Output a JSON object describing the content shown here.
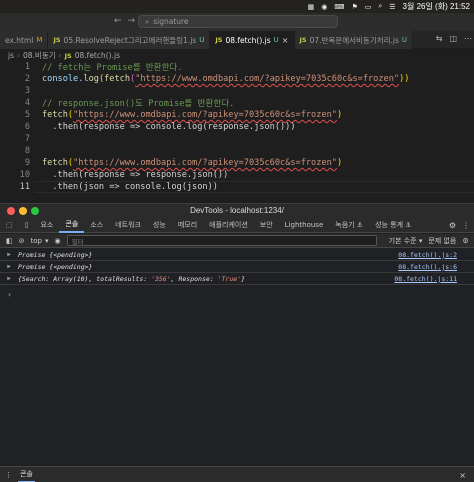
{
  "menubar": {
    "date_time": "3월 26일 (화) 21:52",
    "icons": [
      "menu-extra-icon",
      "wifi-icon",
      "keyboard-icon",
      "flag-icon",
      "battery-icon",
      "search-icon",
      "control-center-icon"
    ]
  },
  "titlebar": {
    "search_placeholder": "signature"
  },
  "tabs": [
    {
      "label": "ex.html",
      "badge": "",
      "status": "M",
      "active": false
    },
    {
      "label": "05.ResolveReject그리고에러핸들링1.js",
      "badge": "JS",
      "status": "U",
      "active": false
    },
    {
      "label": "08.fetch().js",
      "badge": "JS",
      "status": "U",
      "active": true
    },
    {
      "label": "07.반복문에서비동기처리.js",
      "badge": "JS",
      "status": "U",
      "active": false
    }
  ],
  "breadcrumb": [
    "js",
    "08.비동기",
    "08.fetch().js"
  ],
  "breadcrumb_badge": "JS",
  "editor": {
    "lines": [
      {
        "n": "1",
        "cmt": "// fetch는 Promise를 반환한다."
      },
      {
        "n": "2",
        "pre": "console.",
        "fn": "log",
        "a": "(",
        "fn2": "fetch",
        "b": "(",
        "url": "\"https://www.omdbapi.com/?apikey=7035c60c&s=frozen\"",
        "c": "))"
      },
      {
        "n": "3"
      },
      {
        "n": "4",
        "cmt": "// response.json()도 Promise를 반환한다."
      },
      {
        "n": "5",
        "fn": "fetch",
        "a": "(",
        "url": "\"https://www.omdbapi.com/?apikey=7035c60c&s=frozen\"",
        "c": ")"
      },
      {
        "n": "6",
        "text": "  .then(response => console.log(response.json()))"
      },
      {
        "n": "7"
      },
      {
        "n": "8"
      },
      {
        "n": "9",
        "fn": "fetch",
        "a": "(",
        "url": "\"https://www.omdbapi.com/?apikey=7035c60c&s=frozen\"",
        "c": ")"
      },
      {
        "n": "10",
        "text": "  .then(response => response.json())"
      },
      {
        "n": "11",
        "text": "  .then(json => console.log(json))"
      }
    ]
  },
  "devtools": {
    "window_title": "DevTools - localhost:1234/",
    "tabs": [
      "요소",
      "콘솔",
      "소스",
      "네트워크",
      "성능",
      "메모리",
      "애플리케이션",
      "보안",
      "Lighthouse",
      "녹음기 ⚓",
      "성능 통계 ⚓"
    ],
    "active_tab": "콘솔",
    "context": "top",
    "filter_placeholder": "필터",
    "levels": "기본 수준 ▾",
    "issues": "문제 없음",
    "messages": [
      {
        "text": "Promise {<pending>}",
        "source": "08.fetch().js:2"
      },
      {
        "text": "Promise {<pending>}",
        "source": "08.fetch().js:6"
      },
      {
        "text_pre": "{Search: Array(10), totalResults: ",
        "total": "'356'",
        "text_mid": ", Response: ",
        "resp": "'True'",
        "text_post": "}",
        "source": "08.fetch().js:11"
      }
    ],
    "prompt": "›",
    "drawer_tab": "콘솔"
  }
}
